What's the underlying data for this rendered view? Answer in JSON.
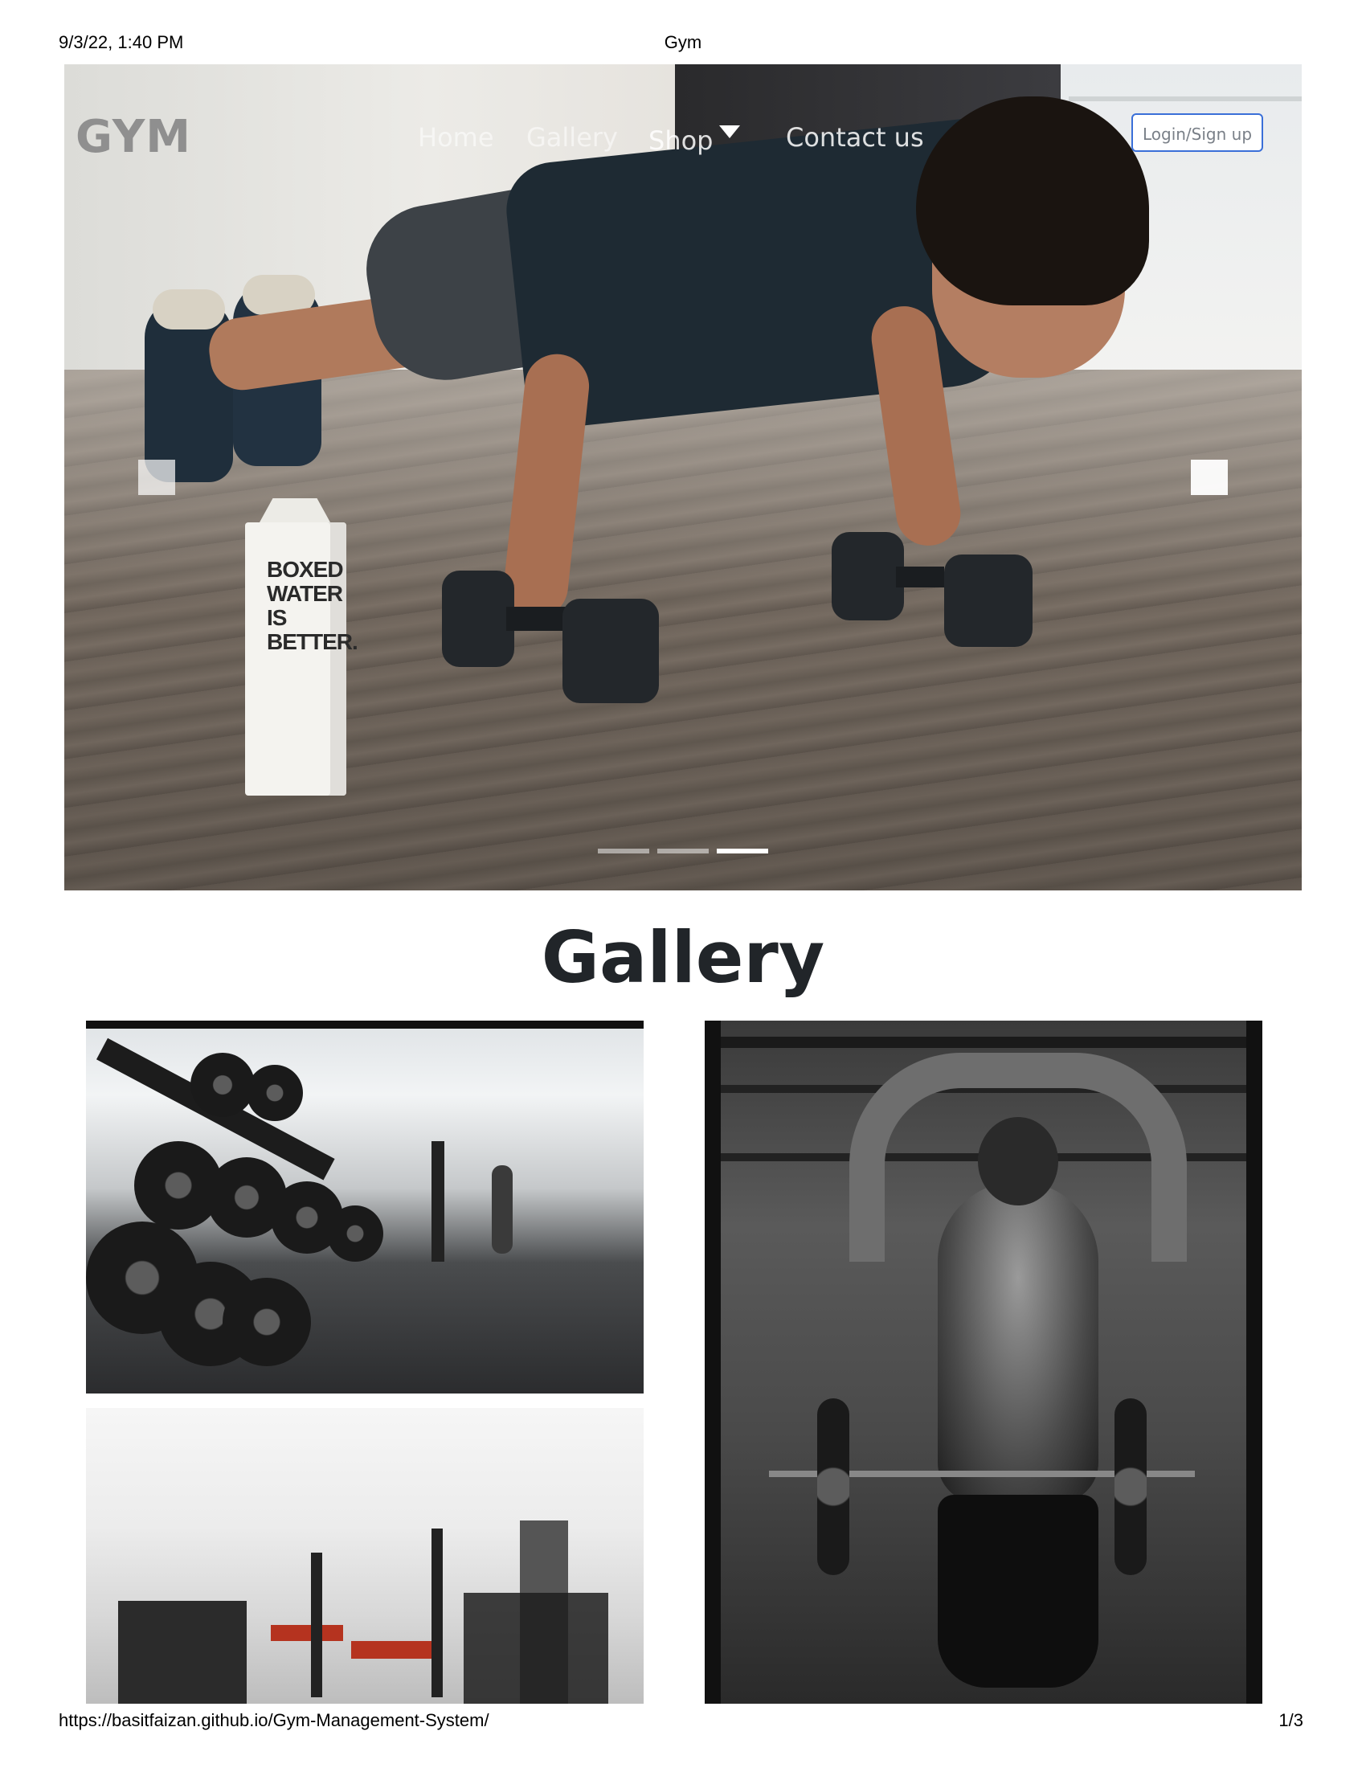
{
  "print_header": {
    "datetime": "9/3/22, 1:40 PM",
    "title": "Gym"
  },
  "print_footer": {
    "url": "https://basitfaizan.github.io/Gym-Management-System/",
    "page": "1/3"
  },
  "navbar": {
    "brand": "GYM",
    "links": [
      "Home",
      "Gallery",
      "Shop",
      "Contact us"
    ],
    "shop_dropdown_icon": "caret-down-icon",
    "login_label": "Login/Sign up",
    "login_border_color": "#3a6fd8"
  },
  "hero": {
    "carton_text": [
      "BOXED",
      "WATER",
      "IS",
      "BETTER."
    ],
    "indicators": [
      {
        "active": false
      },
      {
        "active": false
      },
      {
        "active": true
      }
    ],
    "prev_icon": "carousel-prev-icon",
    "next_icon": "carousel-next-icon"
  },
  "gallery": {
    "title": "Gallery"
  }
}
